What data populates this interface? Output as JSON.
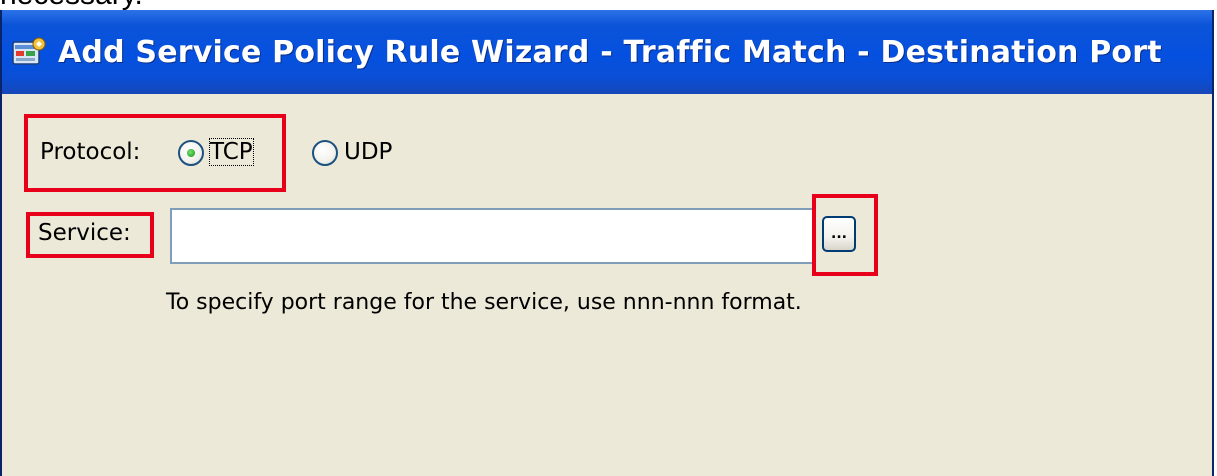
{
  "page": {
    "top_cut_text": "necessary."
  },
  "window": {
    "title": "Add Service Policy Rule Wizard - Traffic Match - Destination Port",
    "icon": "asdm-wizard-icon",
    "title_color": "#ffffff",
    "titlebar_color": "#0550e0"
  },
  "form": {
    "protocol": {
      "label": "Protocol:",
      "options": [
        {
          "label": "TCP",
          "selected": true
        },
        {
          "label": "UDP",
          "selected": false
        }
      ]
    },
    "service": {
      "label": "Service:",
      "value": "",
      "placeholder": "",
      "browse_label": "..."
    },
    "hint": "To specify port range for the service, use nnn-nnn format."
  },
  "annotations": {
    "highlight_color": "#e8001a"
  }
}
